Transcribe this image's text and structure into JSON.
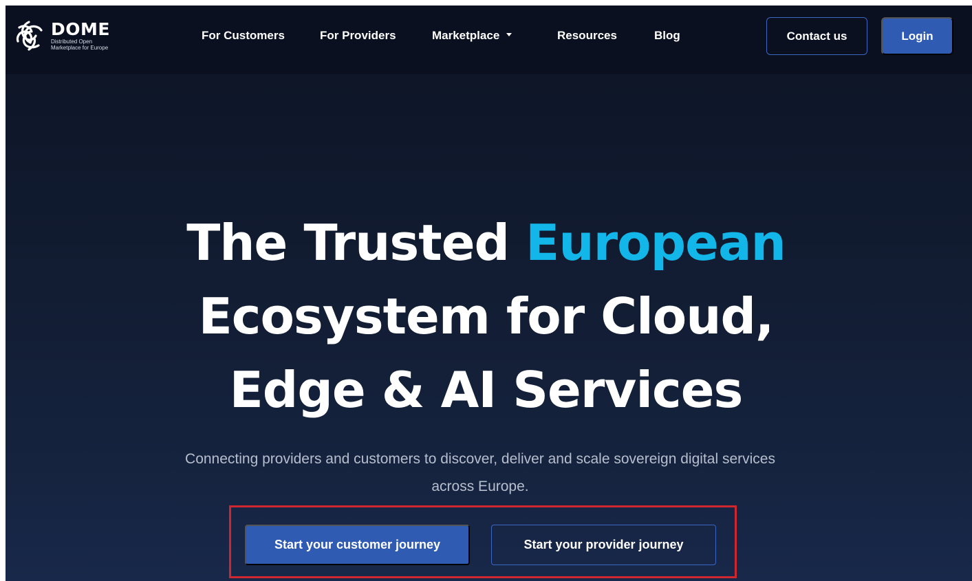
{
  "brand": {
    "name": "DOME",
    "tagline_line1": "Distributed Open",
    "tagline_line2": "Marketplace for Europe",
    "icon": "dome-logo-icon"
  },
  "nav": {
    "items": [
      {
        "label": "For Customers"
      },
      {
        "label": "For Providers"
      },
      {
        "label": "Marketplace",
        "icon": "caret-down-icon"
      },
      {
        "label": "Resources"
      },
      {
        "label": "Blog"
      }
    ],
    "contact_label": "Contact us",
    "login_label": "Login"
  },
  "hero": {
    "title_part1": "The Trusted",
    "title_accent": "European",
    "title_line2": "Ecosystem for Cloud,",
    "title_line3": "Edge & AI Services",
    "subtitle": "Connecting providers and customers to discover, deliver and scale sovereign digital services across Europe.",
    "cta_customer": "Start your customer journey",
    "cta_provider": "Start your provider journey"
  },
  "colors": {
    "accent": "#13b6e8",
    "primary_button": "#2f5bb3",
    "highlight_box": "#d0262d",
    "background": "#0c1424"
  }
}
